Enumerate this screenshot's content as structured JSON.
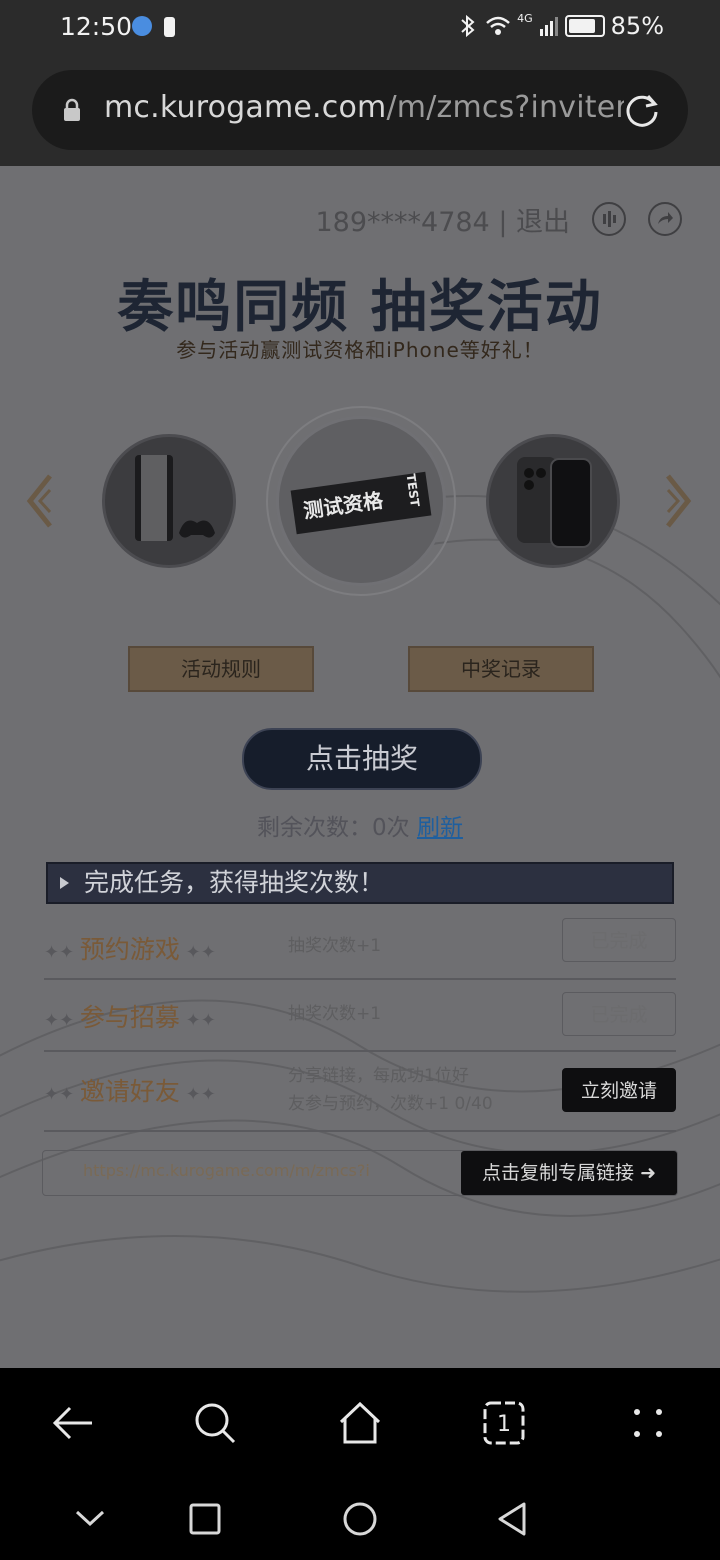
{
  "status_bar": {
    "time": "12:50",
    "network": "4G",
    "battery": "85%"
  },
  "browser": {
    "url_main": "mc.kurogame.com",
    "url_path": "/m/zmcs?inviter"
  },
  "user": {
    "masked_phone": "189****4784",
    "separator": " | ",
    "logout": "退出"
  },
  "header": {
    "title": "奏鸣同频 抽奖活动",
    "subtitle": "参与活动赢测试资格和iPhone等好礼！"
  },
  "prizes": {
    "center_ticket_text": "测试资格",
    "center_ticket_tag": "TEST"
  },
  "tabs": {
    "rules": "活动规则",
    "records": "中奖记录"
  },
  "draw": {
    "button_label": "点击抽奖",
    "remaining_label": "剩余次数：",
    "remaining_value": "0次",
    "refresh_label": "刷新"
  },
  "tasks": {
    "header": "完成任务，获得抽奖次数！",
    "rows": [
      {
        "name": "预约游戏",
        "reward": "抽奖次数+1",
        "button": "已完成"
      },
      {
        "name": "参与招募",
        "reward": "抽奖次数+1",
        "button": "已完成"
      },
      {
        "name": "邀请好友",
        "reward_line1": "分享链接，每成功1位好",
        "reward_line2": "友参与预约，次数+1 0/40",
        "button": "立刻邀请"
      }
    ]
  },
  "invite": {
    "link": "https://mc.kurogame.com/m/zmcs?i",
    "copy_button": "点击复制专属链接"
  }
}
